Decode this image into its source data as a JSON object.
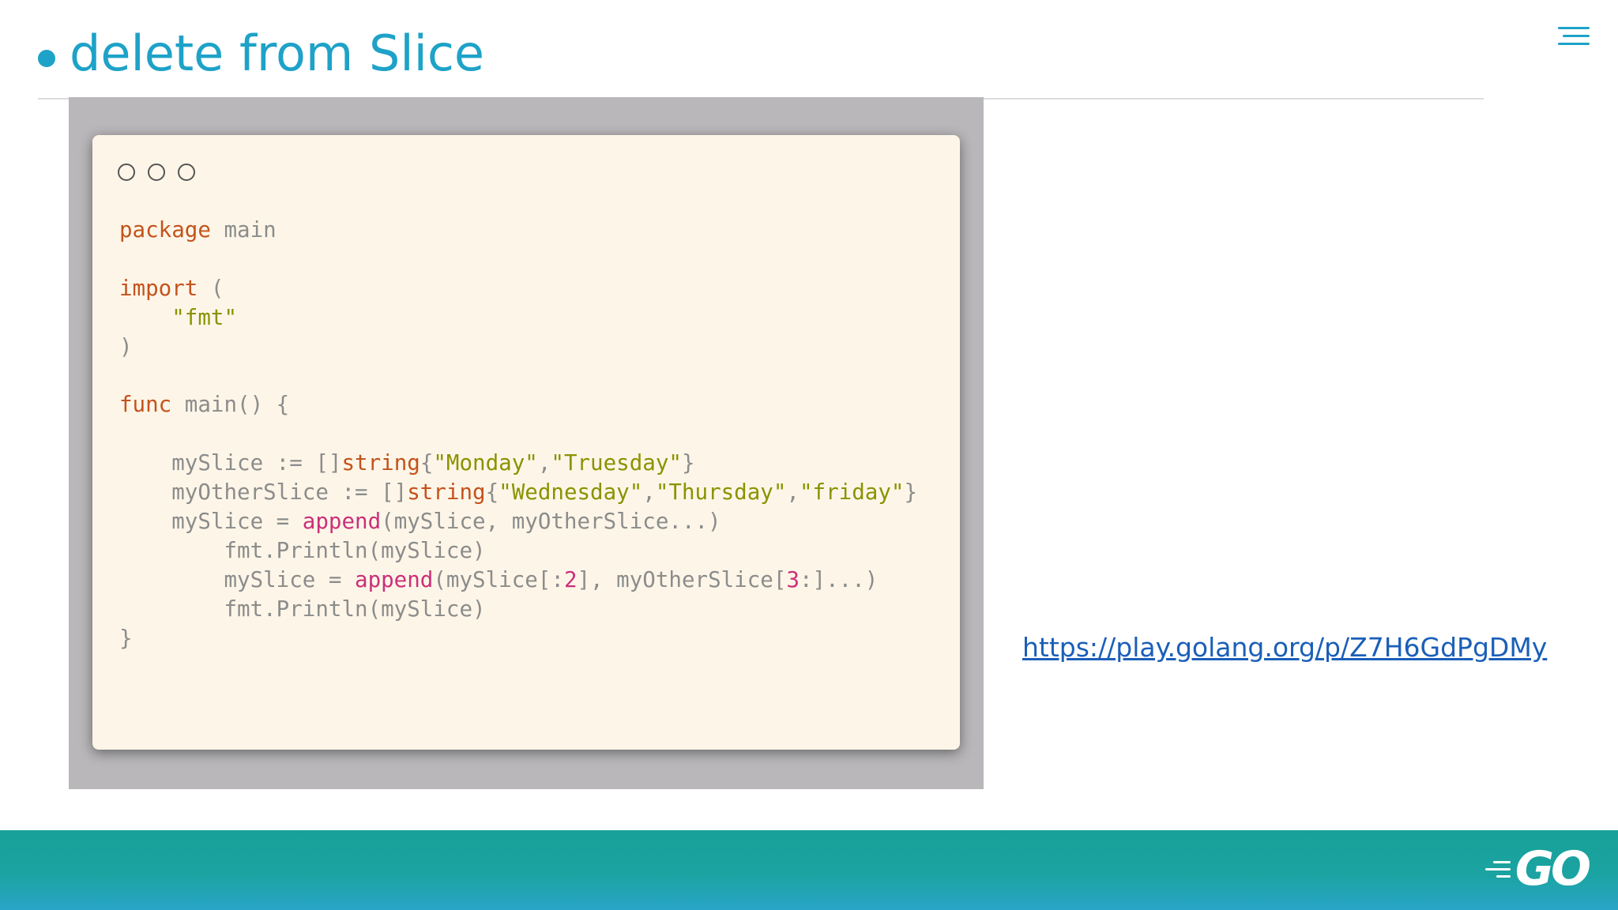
{
  "slide": {
    "title": "delete from Slice",
    "link": "https://play.golang.org/p/Z7H6GdPgDMy",
    "accent_color": "#1ea2c8",
    "footer_logo": "GO"
  },
  "code": {
    "l1_kw": "package",
    "l1_rest": " main",
    "l3_kw": "import",
    "l3_rest": " (",
    "l4_indent": "    ",
    "l4_str": "\"fmt\"",
    "l5": ")",
    "l7_kw": "func",
    "l7_rest": " main() {",
    "l9_pre": "    mySlice := []",
    "l9_kw": "string",
    "l9_p1": "{",
    "l9_s1": "\"Monday\"",
    "l9_p2": ",",
    "l9_s2": "\"Truesday\"",
    "l9_p3": "}",
    "l10_pre": "    myOtherSlice := []",
    "l10_kw": "string",
    "l10_p1": "{",
    "l10_s1": "\"Wednesday\"",
    "l10_p2": ",",
    "l10_s2": "\"Thursday\"",
    "l10_p3": ",",
    "l10_s3": "\"friday\"",
    "l10_p4": "}",
    "l11_pre": "    mySlice = ",
    "l11_fn": "append",
    "l11_rest": "(mySlice, myOtherSlice...)",
    "l12": "        fmt.Println(mySlice)",
    "l13_pre": "        mySlice = ",
    "l13_fn": "append",
    "l13_a": "(mySlice[:",
    "l13_n1": "2",
    "l13_b": "], myOtherSlice[",
    "l13_n2": "3",
    "l13_c": ":]...)",
    "l14": "        fmt.Println(mySlice)",
    "l15": "}"
  }
}
